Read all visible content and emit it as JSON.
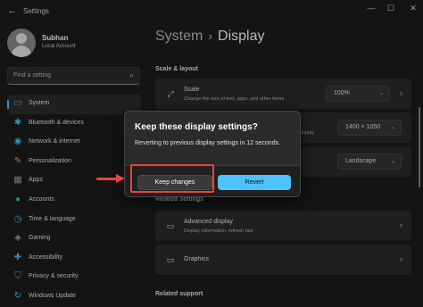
{
  "window": {
    "title": "Settings",
    "back_glyph": "←",
    "minimize_glyph": "—",
    "maximize_glyph": "☐",
    "close_glyph": "✕"
  },
  "user": {
    "name": "Subhan",
    "account_type": "Local Account"
  },
  "search": {
    "placeholder": "Find a setting",
    "icon": "search-icon",
    "icon_glyph": "⌕"
  },
  "sidebar": {
    "items": [
      {
        "label": "System",
        "icon": "monitor-icon",
        "glyph": "▭",
        "color": "#4cc2ff",
        "selected": true
      },
      {
        "label": "Bluetooth & devices",
        "icon": "bluetooth-icon",
        "glyph": "✱",
        "color": "#4cc2ff"
      },
      {
        "label": "Network & internet",
        "icon": "wifi-icon",
        "glyph": "◉",
        "color": "#4cc2ff"
      },
      {
        "label": "Personalization",
        "icon": "brush-icon",
        "glyph": "✎",
        "color": "#f0a35e"
      },
      {
        "label": "Apps",
        "icon": "apps-icon",
        "glyph": "▦",
        "color": "#9aa7b8"
      },
      {
        "label": "Accounts",
        "icon": "person-icon",
        "glyph": "●",
        "color": "#36c08a"
      },
      {
        "label": "Time & language",
        "icon": "clock-globe-icon",
        "glyph": "◷",
        "color": "#4cc2ff"
      },
      {
        "label": "Gaming",
        "icon": "gamepad-icon",
        "glyph": "◈",
        "color": "#9aa7b8"
      },
      {
        "label": "Accessibility",
        "icon": "accessibility-icon",
        "glyph": "✚",
        "color": "#4cc2ff"
      },
      {
        "label": "Privacy & security",
        "icon": "shield-icon",
        "glyph": "⛉",
        "color": "#9aa7b8"
      },
      {
        "label": "Windows Update",
        "icon": "update-icon",
        "glyph": "↻",
        "color": "#4cc2ff"
      }
    ]
  },
  "main": {
    "breadcrumb_parent": "System",
    "breadcrumb_sep": "›",
    "breadcrumb_current": "Display",
    "scale_layout_heading": "Scale & layout",
    "scale": {
      "title": "Scale",
      "subtitle": "Change the size of text, apps, and other items",
      "value": "100%",
      "icon": "scale-icon",
      "glyph": "⤢"
    },
    "resolution": {
      "subtitle_fragment": "isplay",
      "value": "1400 × 1050"
    },
    "orientation": {
      "value": "Landscape"
    },
    "related_settings_heading": "Related settings",
    "advanced_display": {
      "title": "Advanced display",
      "subtitle": "Display information, refresh rate",
      "icon": "monitor-icon",
      "glyph": "▭"
    },
    "graphics": {
      "title": "Graphics",
      "icon": "graphics-icon",
      "glyph": "▭"
    },
    "related_support_heading": "Related support",
    "chevron": "›",
    "caret": "⌄"
  },
  "dialog": {
    "title": "Keep these display settings?",
    "message": "Reverting to previous display settings in 12 seconds.",
    "keep_label": "Keep changes",
    "revert_label": "Revert",
    "accent_color": "#4cc2ff"
  },
  "annotation": {
    "highlight_color": "#e8453c"
  }
}
